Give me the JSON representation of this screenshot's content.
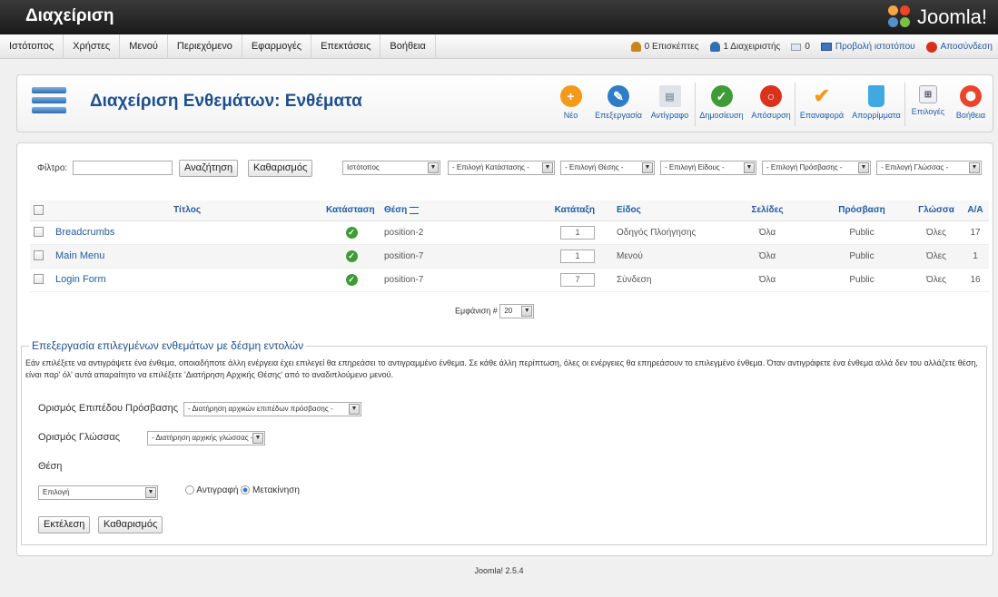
{
  "header": {
    "title": "Διαχείριση",
    "logo_text": "Joomla!"
  },
  "menu": {
    "items": [
      "Ιστότοπος",
      "Χρήστες",
      "Μενού",
      "Περιεχόμενο",
      "Εφαρμογές",
      "Επεκτάσεις",
      "Βοήθεια"
    ],
    "status": {
      "visitors": "0 Επισκέπτες",
      "admins": "1 Διαχειριστής",
      "messages": "0",
      "view_site": "Προβολή ιστοτόπου",
      "logout": "Αποσύνδεση"
    }
  },
  "toolbar": {
    "page_title": "Διαχείριση Ενθεμάτων: Ενθέματα",
    "buttons": {
      "new": "Νέο",
      "edit": "Επεξεργασία",
      "copy": "Αντίγραφο",
      "publish": "Δημοσίευση",
      "unpublish": "Απόσυρση",
      "checkin": "Επαναφορά",
      "trash": "Απορρίμματα",
      "options": "Επιλογές",
      "help": "Βοήθεια"
    },
    "colors": {
      "new": "#f39a1d",
      "edit": "#2d7ec8",
      "publish": "#3f9b35",
      "unpublish": "#d9331c",
      "trash": "#3fa9e0"
    }
  },
  "filters": {
    "label": "Φίλτρο:",
    "search_value": "",
    "search_button": "Αναζήτηση",
    "clear_button": "Καθαρισμός",
    "client": "Ιστότοπος",
    "state": "- Επιλογή Κατάστασης -",
    "position": "- Επιλογή Θέσης -",
    "type": "- Επιλογή Είδους -",
    "access": "- Επιλογή Πρόσβασης -",
    "language": "- Επιλογή Γλώσσας -"
  },
  "table": {
    "headers": {
      "title": "Τίτλος",
      "status": "Κατάσταση",
      "position": "Θέση",
      "ordering": "Κατάταξη",
      "type": "Είδος",
      "pages": "Σελίδες",
      "access": "Πρόσβαση",
      "language": "Γλώσσα",
      "id": "Α/Α"
    },
    "rows": [
      {
        "title": "Breadcrumbs",
        "position": "position-2",
        "ordering": "1",
        "type": "Οδηγός Πλοήγησης",
        "pages": "Όλα",
        "access": "Public",
        "language": "Όλες",
        "id": "17"
      },
      {
        "title": "Main Menu",
        "position": "position-7",
        "ordering": "1",
        "type": "Μενού",
        "pages": "Όλα",
        "access": "Public",
        "language": "Όλες",
        "id": "1"
      },
      {
        "title": "Login Form",
        "position": "position-7",
        "ordering": "7",
        "type": "Σύνδεση",
        "pages": "Όλα",
        "access": "Public",
        "language": "Όλες",
        "id": "16"
      }
    ],
    "display_label": "Εμφάνιση #",
    "display_value": "20"
  },
  "batch": {
    "legend": "Επεξεργασία επιλεγμένων ενθεμάτων με δέσμη εντολών",
    "description": "Εάν επιλέξετε να αντιγράψετε ένα ένθεμα, οποιαδήποτε άλλη ενέργεια έχει επιλεγεί θα επηρεάσει το αντιγραμμένο ένθεμα. Σε κάθε άλλη περίπτωση, όλες οι ενέργειες θα επηρεάσουν το επιλεγμένο ένθεμα. Όταν αντιγράφετε ένα ένθεμα αλλά δεν του αλλάζετε θέση, είναι παρ' όλ' αυτά απαραίτητο να επιλέξετε 'Διατήρηση Αρχικής Θέσης' από το αναδιπλούμενο μενού.",
    "access_label": "Ορισμός Επιπέδου Πρόσβασης",
    "access_value": "- Διατήρηση αρχικών επιπέδων πρόσβασης -",
    "language_label": "Ορισμός Γλώσσας",
    "language_value": "- Διατήρηση αρχικής γλώσσας -",
    "position_label": "Θέση",
    "position_value": "Επιλογή",
    "copy_label": "Αντιγραφή",
    "move_label": "Μετακίνηση",
    "execute_button": "Εκτέλεση",
    "clear_button": "Καθαρισμός"
  },
  "footer": {
    "version": "Joomla! 2.5.4"
  }
}
